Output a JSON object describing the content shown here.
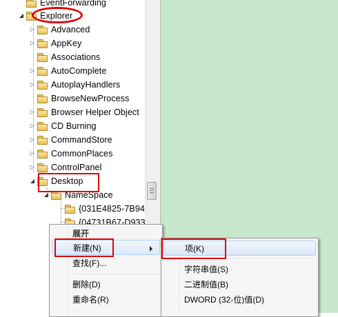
{
  "tree": {
    "nodes": [
      {
        "id": "eventforwarding",
        "label": "EventForwarding",
        "expander": "none"
      },
      {
        "id": "explorer",
        "label": "Explorer",
        "expander": "expanded"
      },
      {
        "id": "advanced",
        "label": "Advanced",
        "expander": "collapsed"
      },
      {
        "id": "appkey",
        "label": "AppKey",
        "expander": "collapsed"
      },
      {
        "id": "associations",
        "label": "Associations",
        "expander": "none"
      },
      {
        "id": "autocomplete",
        "label": "AutoComplete",
        "expander": "collapsed"
      },
      {
        "id": "autoplayhandlers",
        "label": "AutoplayHandlers",
        "expander": "collapsed"
      },
      {
        "id": "browsenewprocess",
        "label": "BrowseNewProcess",
        "expander": "none"
      },
      {
        "id": "browser-helper-objects",
        "label": "Browser Helper Object",
        "expander": "collapsed"
      },
      {
        "id": "cd-burning",
        "label": "CD Burning",
        "expander": "collapsed"
      },
      {
        "id": "commandstore",
        "label": "CommandStore",
        "expander": "collapsed"
      },
      {
        "id": "commonplaces",
        "label": "CommonPlaces",
        "expander": "collapsed"
      },
      {
        "id": "controlpanel",
        "label": "ControlPanel",
        "expander": "collapsed"
      },
      {
        "id": "desktop",
        "label": "Desktop",
        "expander": "expanded"
      },
      {
        "id": "namespace",
        "label": "NameSpace",
        "expander": "expanded"
      },
      {
        "id": "guid-031e",
        "label": "{031E4825-7B94",
        "expander": "none"
      },
      {
        "id": "guid-0473",
        "label": "{04731B67-D933",
        "expander": "none"
      }
    ]
  },
  "context_menu": {
    "header": "展开",
    "new": "新建(N)",
    "find": "查找(F)...",
    "delete": "删除(D)",
    "rename": "重命名(R)"
  },
  "new_submenu": {
    "key": "项(K)",
    "string": "字符串值(S)",
    "binary": "二进制值(B)",
    "dword": "DWORD (32-位)值(D)"
  },
  "colors": {
    "right_pane": "#c7e8cc",
    "annotation": "#e00000",
    "menu_highlight": "#dbe8f8"
  },
  "icons": {
    "folder": "folder-icon",
    "expand": "triangle-right-icon",
    "collapse": "triangle-down-icon",
    "submenu": "chevron-right-icon"
  }
}
